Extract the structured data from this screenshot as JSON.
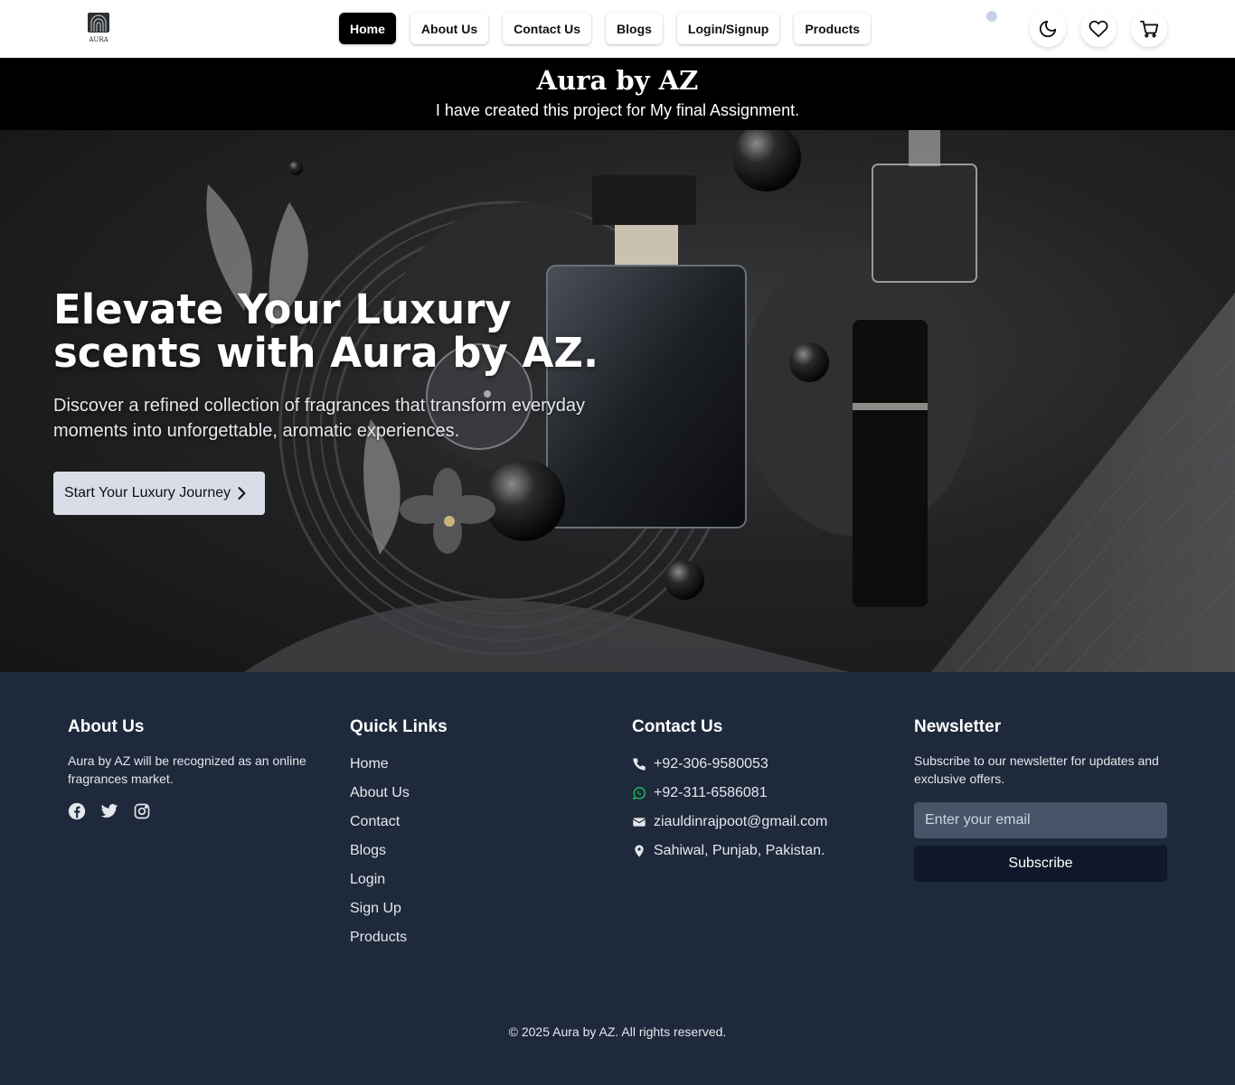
{
  "header": {
    "logo_text": "AURA",
    "nav": [
      "Home",
      "About Us",
      "Contact Us",
      "Blogs",
      "Login/Signup",
      "Products"
    ],
    "active_nav": "Home",
    "icons": [
      "moon-icon",
      "heart-icon",
      "cart-icon"
    ]
  },
  "banner": {
    "title": "Aura by AZ",
    "subtitle": "I have created this project for My final Assignment."
  },
  "hero": {
    "title": "Elevate Your Luxury scents with Aura by AZ.",
    "description": "Discover a refined collection of fragrances that transform everyday moments into unforgettable, aromatic experiences.",
    "button_label": "Start Your Luxury Journey"
  },
  "footer": {
    "about": {
      "heading": "About Us",
      "text": "Aura by AZ will be recognized as an online fragrances market.",
      "social": [
        "facebook-icon",
        "twitter-icon",
        "instagram-icon"
      ]
    },
    "quick_links": {
      "heading": "Quick Links",
      "items": [
        "Home",
        "About Us",
        "Contact",
        "Blogs",
        "Login",
        "Sign Up",
        "Products"
      ]
    },
    "contact": {
      "heading": "Contact Us",
      "phone": "+92-306-9580053",
      "whatsapp": "+92-311-6586081",
      "email": "ziauldinrajpoot@gmail.com",
      "address": "Sahiwal, Punjab, Pakistan."
    },
    "newsletter": {
      "heading": "Newsletter",
      "text": "Subscribe to our newsletter for updates and exclusive offers.",
      "placeholder": "Enter your email",
      "button_label": "Subscribe"
    },
    "copyright": "© 2025 Aura by AZ. All rights reserved."
  },
  "colors": {
    "footer_bg": "#1e293b",
    "banner_bg": "#000000",
    "subscribe_bg": "#0f172a",
    "whatsapp": "#22c55e"
  }
}
